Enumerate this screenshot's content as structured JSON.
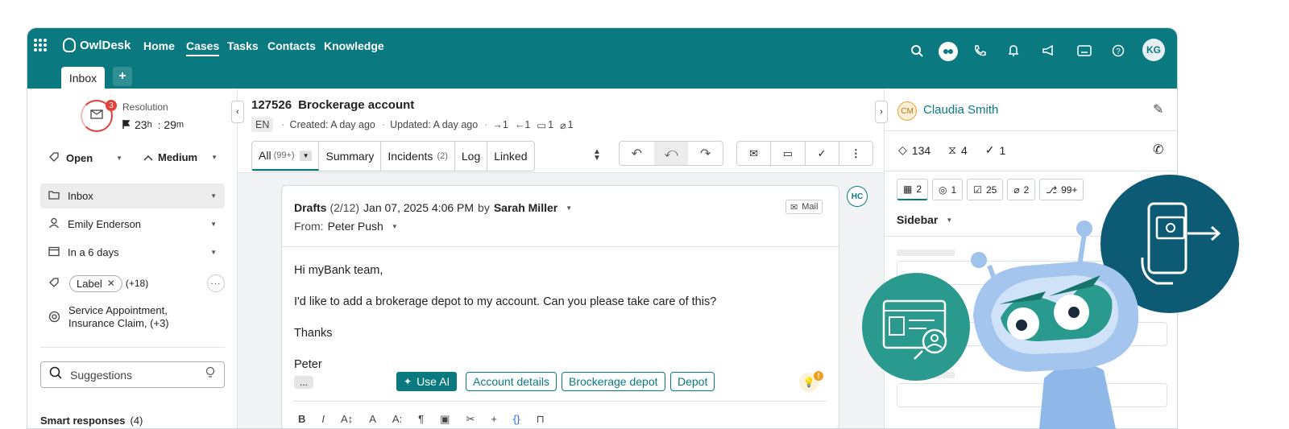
{
  "app": {
    "logo": "OwlDesk",
    "nav": [
      "Home",
      "Cases",
      "Tasks",
      "Contacts",
      "Knowledge"
    ],
    "active_nav": "Cases",
    "avatar": "KG"
  },
  "tabs": {
    "inbox": "Inbox",
    "add": "+"
  },
  "left": {
    "resolution_label": "Resolution",
    "resolution_badge": "3",
    "resolution_hours": "23",
    "resolution_h": "h",
    "resolution_sep": ":",
    "resolution_minutes": "29",
    "resolution_m": "m",
    "status": "Open",
    "priority": "Medium",
    "queue": "Inbox",
    "assignee": "Emily Enderson",
    "due": "In a 6 days",
    "label": "Label",
    "label_more": "(+18)",
    "services_line1": "Service Appointment,",
    "services_line2": "Insurance Claim, (+3)",
    "suggestions_placeholder": "Suggestions",
    "smart_responses": "Smart responses",
    "smart_count": "(4)"
  },
  "case": {
    "id": "127526",
    "title": "Brockerage account",
    "lang": "EN",
    "created": "Created: A day ago",
    "updated": "Updated: A day ago",
    "out": "1",
    "in": "1",
    "comments": "1",
    "attachments": "1",
    "tabs": {
      "all": "All",
      "all_count": "(99+)",
      "summary": "Summary",
      "incidents": "Incidents",
      "incidents_count": "(2)",
      "log": "Log",
      "linked": "Linked"
    }
  },
  "message": {
    "drafts": "Drafts",
    "drafts_count": "(2/12)",
    "date": "Jan 07, 2025 4:06 PM",
    "by": "by",
    "author": "Sarah Miller",
    "from_label": "From:",
    "from_name": "Peter Push",
    "mail_badge": "Mail",
    "hc": "HC",
    "body": [
      "Hi myBank team,",
      "I'd like to add a brokerage depot to my account. Can you please take care of this?",
      "Thanks",
      "Peter"
    ],
    "use_ai": "Use AI",
    "chips": [
      "Account details",
      "Brockerage depot",
      "Depot"
    ],
    "more": "..."
  },
  "contact": {
    "initials": "CM",
    "name": "Claudia Smith",
    "stats": {
      "tickets": "134",
      "waiting": "4",
      "done": "1"
    },
    "tabs": [
      "2",
      "1",
      "25",
      "2",
      "99+"
    ],
    "sidebar": "Sidebar"
  },
  "colors": {
    "brand": "#0b7a80",
    "badge": "#e4403b",
    "hover": "#ececec"
  }
}
